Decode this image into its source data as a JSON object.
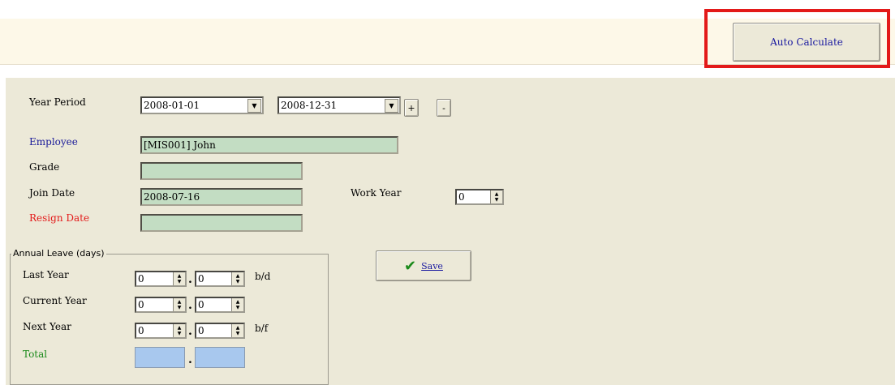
{
  "toolbar": {
    "auto_calculate_label": "Auto Calculate"
  },
  "form": {
    "year_period_label": "Year Period",
    "period_start": "2008-01-01",
    "period_end": "2008-12-31",
    "add_button": "+",
    "remove_button": "-",
    "employee_label": "Employee",
    "employee_value": "[MIS001] John",
    "grade_label": "Grade",
    "grade_value": "",
    "join_date_label": "Join Date",
    "join_date_value": "2008-07-16",
    "resign_date_label": "Resign Date",
    "resign_date_value": "",
    "work_year_label": "Work Year",
    "work_year_value": "0"
  },
  "annual_leave": {
    "title": "Annual Leave (days)",
    "last_year_label": "Last Year",
    "last_year_a": "0",
    "last_year_b": "0",
    "last_year_suffix": "b/d",
    "current_year_label": "Current Year",
    "current_year_a": "0",
    "current_year_b": "0",
    "next_year_label": "Next Year",
    "next_year_a": "0",
    "next_year_b": "0",
    "next_year_suffix": "b/f",
    "total_label": "Total",
    "total_a": "",
    "total_b": "",
    "separator": "."
  },
  "save_label": "Save",
  "colors": {
    "employee_label": "#1a1a99",
    "resign_label": "#e31a1a",
    "total_label": "#1a8a1a",
    "highlight": "#e31a1a"
  },
  "icons": {
    "dropdown": "chevron-down-icon",
    "spinner": "spinner-arrows-icon",
    "save": "checkmark-icon"
  }
}
